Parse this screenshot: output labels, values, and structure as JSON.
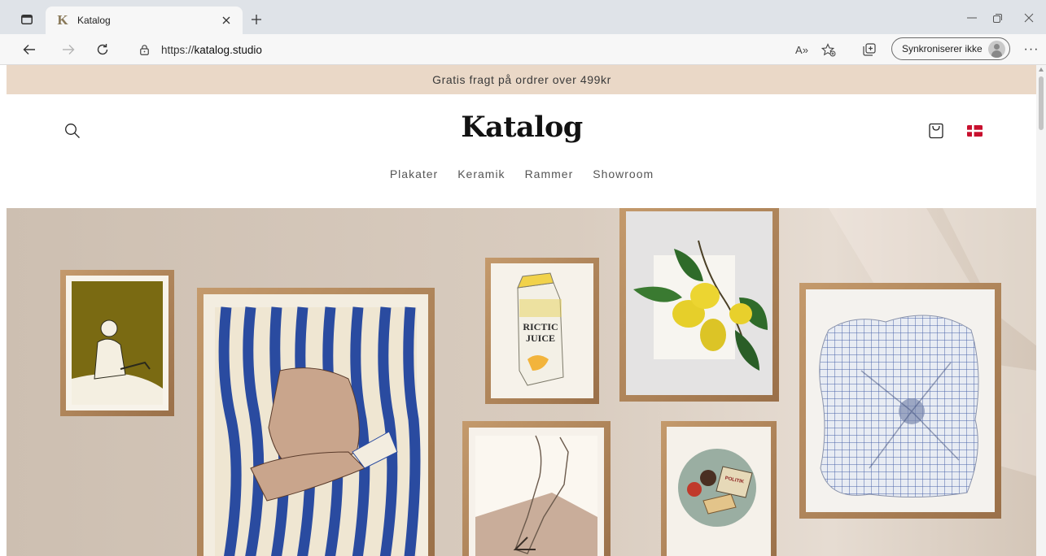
{
  "browser": {
    "tab_title": "Katalog",
    "favicon_letter": "K",
    "url_prefix": "https://",
    "url_host": "katalog.studio",
    "read_aloud_label": "A»",
    "sync_label": "Synkroniserer ikke",
    "more_label": "···"
  },
  "colors": {
    "announcement_bg": "#ead8c7",
    "flag_red": "#c8102e",
    "frame_oak": "#b08558"
  },
  "announcement": {
    "text": "Gratis fragt på ordrer over 499kr"
  },
  "header": {
    "logo": "Katalog",
    "nav": [
      {
        "label": "Plakater"
      },
      {
        "label": "Keramik"
      },
      {
        "label": "Rammer"
      },
      {
        "label": "Showroom"
      }
    ]
  },
  "hero": {
    "poster_text_line1": "RICTIC",
    "poster_text_line2": "JUICE",
    "magazine_text": "POLITIK"
  }
}
